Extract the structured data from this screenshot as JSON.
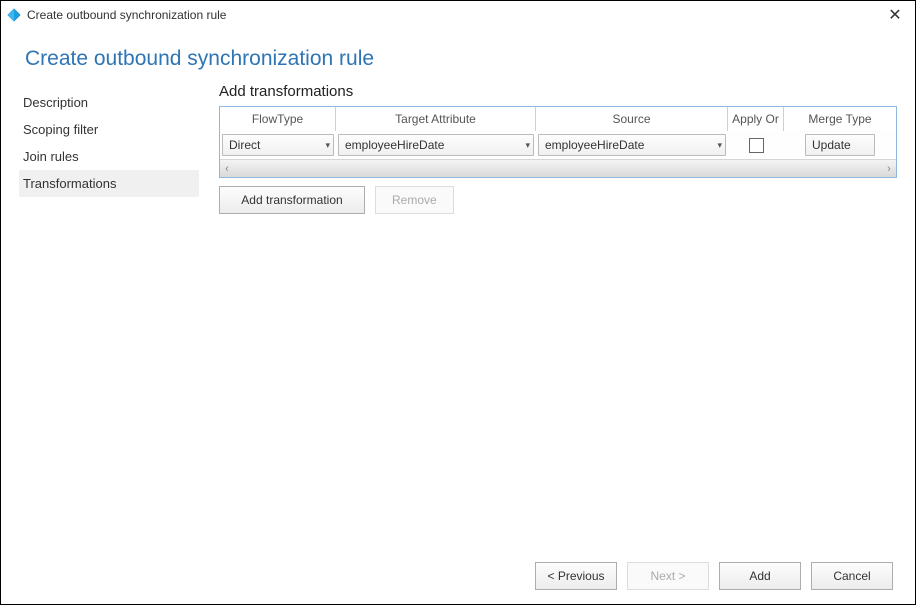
{
  "window": {
    "title": "Create outbound synchronization rule",
    "close_symbol": "✕"
  },
  "page": {
    "title": "Create outbound synchronization rule"
  },
  "sidebar": {
    "items": [
      {
        "label": "Description",
        "active": false
      },
      {
        "label": "Scoping filter",
        "active": false
      },
      {
        "label": "Join rules",
        "active": false
      },
      {
        "label": "Transformations",
        "active": true
      }
    ]
  },
  "section": {
    "title": "Add transformations",
    "headers": {
      "flowtype": "FlowType",
      "target": "Target Attribute",
      "source": "Source",
      "apply": "Apply Or",
      "merge": "Merge Type"
    },
    "row": {
      "flowtype": "Direct",
      "target": "employeeHireDate",
      "source": "employeeHireDate",
      "apply_checked": false,
      "merge": "Update"
    },
    "buttons": {
      "add_transformation": "Add transformation",
      "remove": "Remove"
    }
  },
  "footer": {
    "previous": "< Previous",
    "next": "Next >",
    "add": "Add",
    "cancel": "Cancel"
  },
  "icons": {
    "chevron_down": "▾",
    "scroll_left": "‹",
    "scroll_right": "›"
  }
}
